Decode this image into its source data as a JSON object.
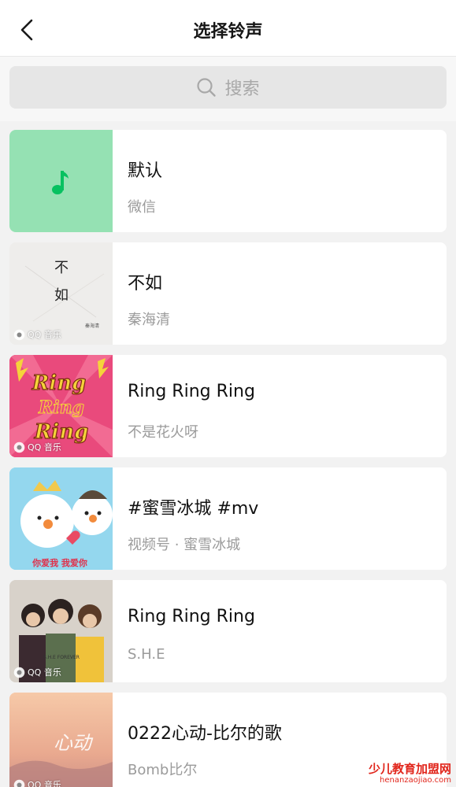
{
  "header": {
    "title": "选择铃声",
    "back_icon": "chevron-left-icon"
  },
  "search": {
    "placeholder": "搜索",
    "icon": "search-icon"
  },
  "badge_label": "QQ 音乐",
  "songs": [
    {
      "title": "默认",
      "subtitle": "微信",
      "art": "default-note",
      "art_color": "#95e1b3",
      "note_color": "#07c160"
    },
    {
      "title": "不如",
      "subtitle": "秦海清",
      "art": "buru-cover",
      "art_text_top": "不",
      "art_text_bottom": "如",
      "art_tag": "秦海清",
      "badge": true
    },
    {
      "title": "Ring Ring Ring",
      "subtitle": "不是花火呀",
      "art": "ring-cover",
      "art_line1": "Ring",
      "art_line2": "Ring",
      "art_line3": "Ring",
      "badge": true
    },
    {
      "title": "#蜜雪冰城 #mv",
      "subtitle": "视频号 · 蜜雪冰城",
      "art": "snowman-cover",
      "art_caption": "你爱我  我爱你"
    },
    {
      "title": "Ring Ring Ring",
      "subtitle": "S.H.E",
      "art": "she-cover",
      "art_caption": "S.H.E FOREVER",
      "badge": true
    },
    {
      "title": "0222心动-比尔的歌",
      "subtitle": "Bomb比尔",
      "art": "heart-cover",
      "art_text": "心动",
      "badge": true
    }
  ],
  "watermark": {
    "text": "少儿教育加盟网",
    "url": "henanzaojiao.com"
  }
}
